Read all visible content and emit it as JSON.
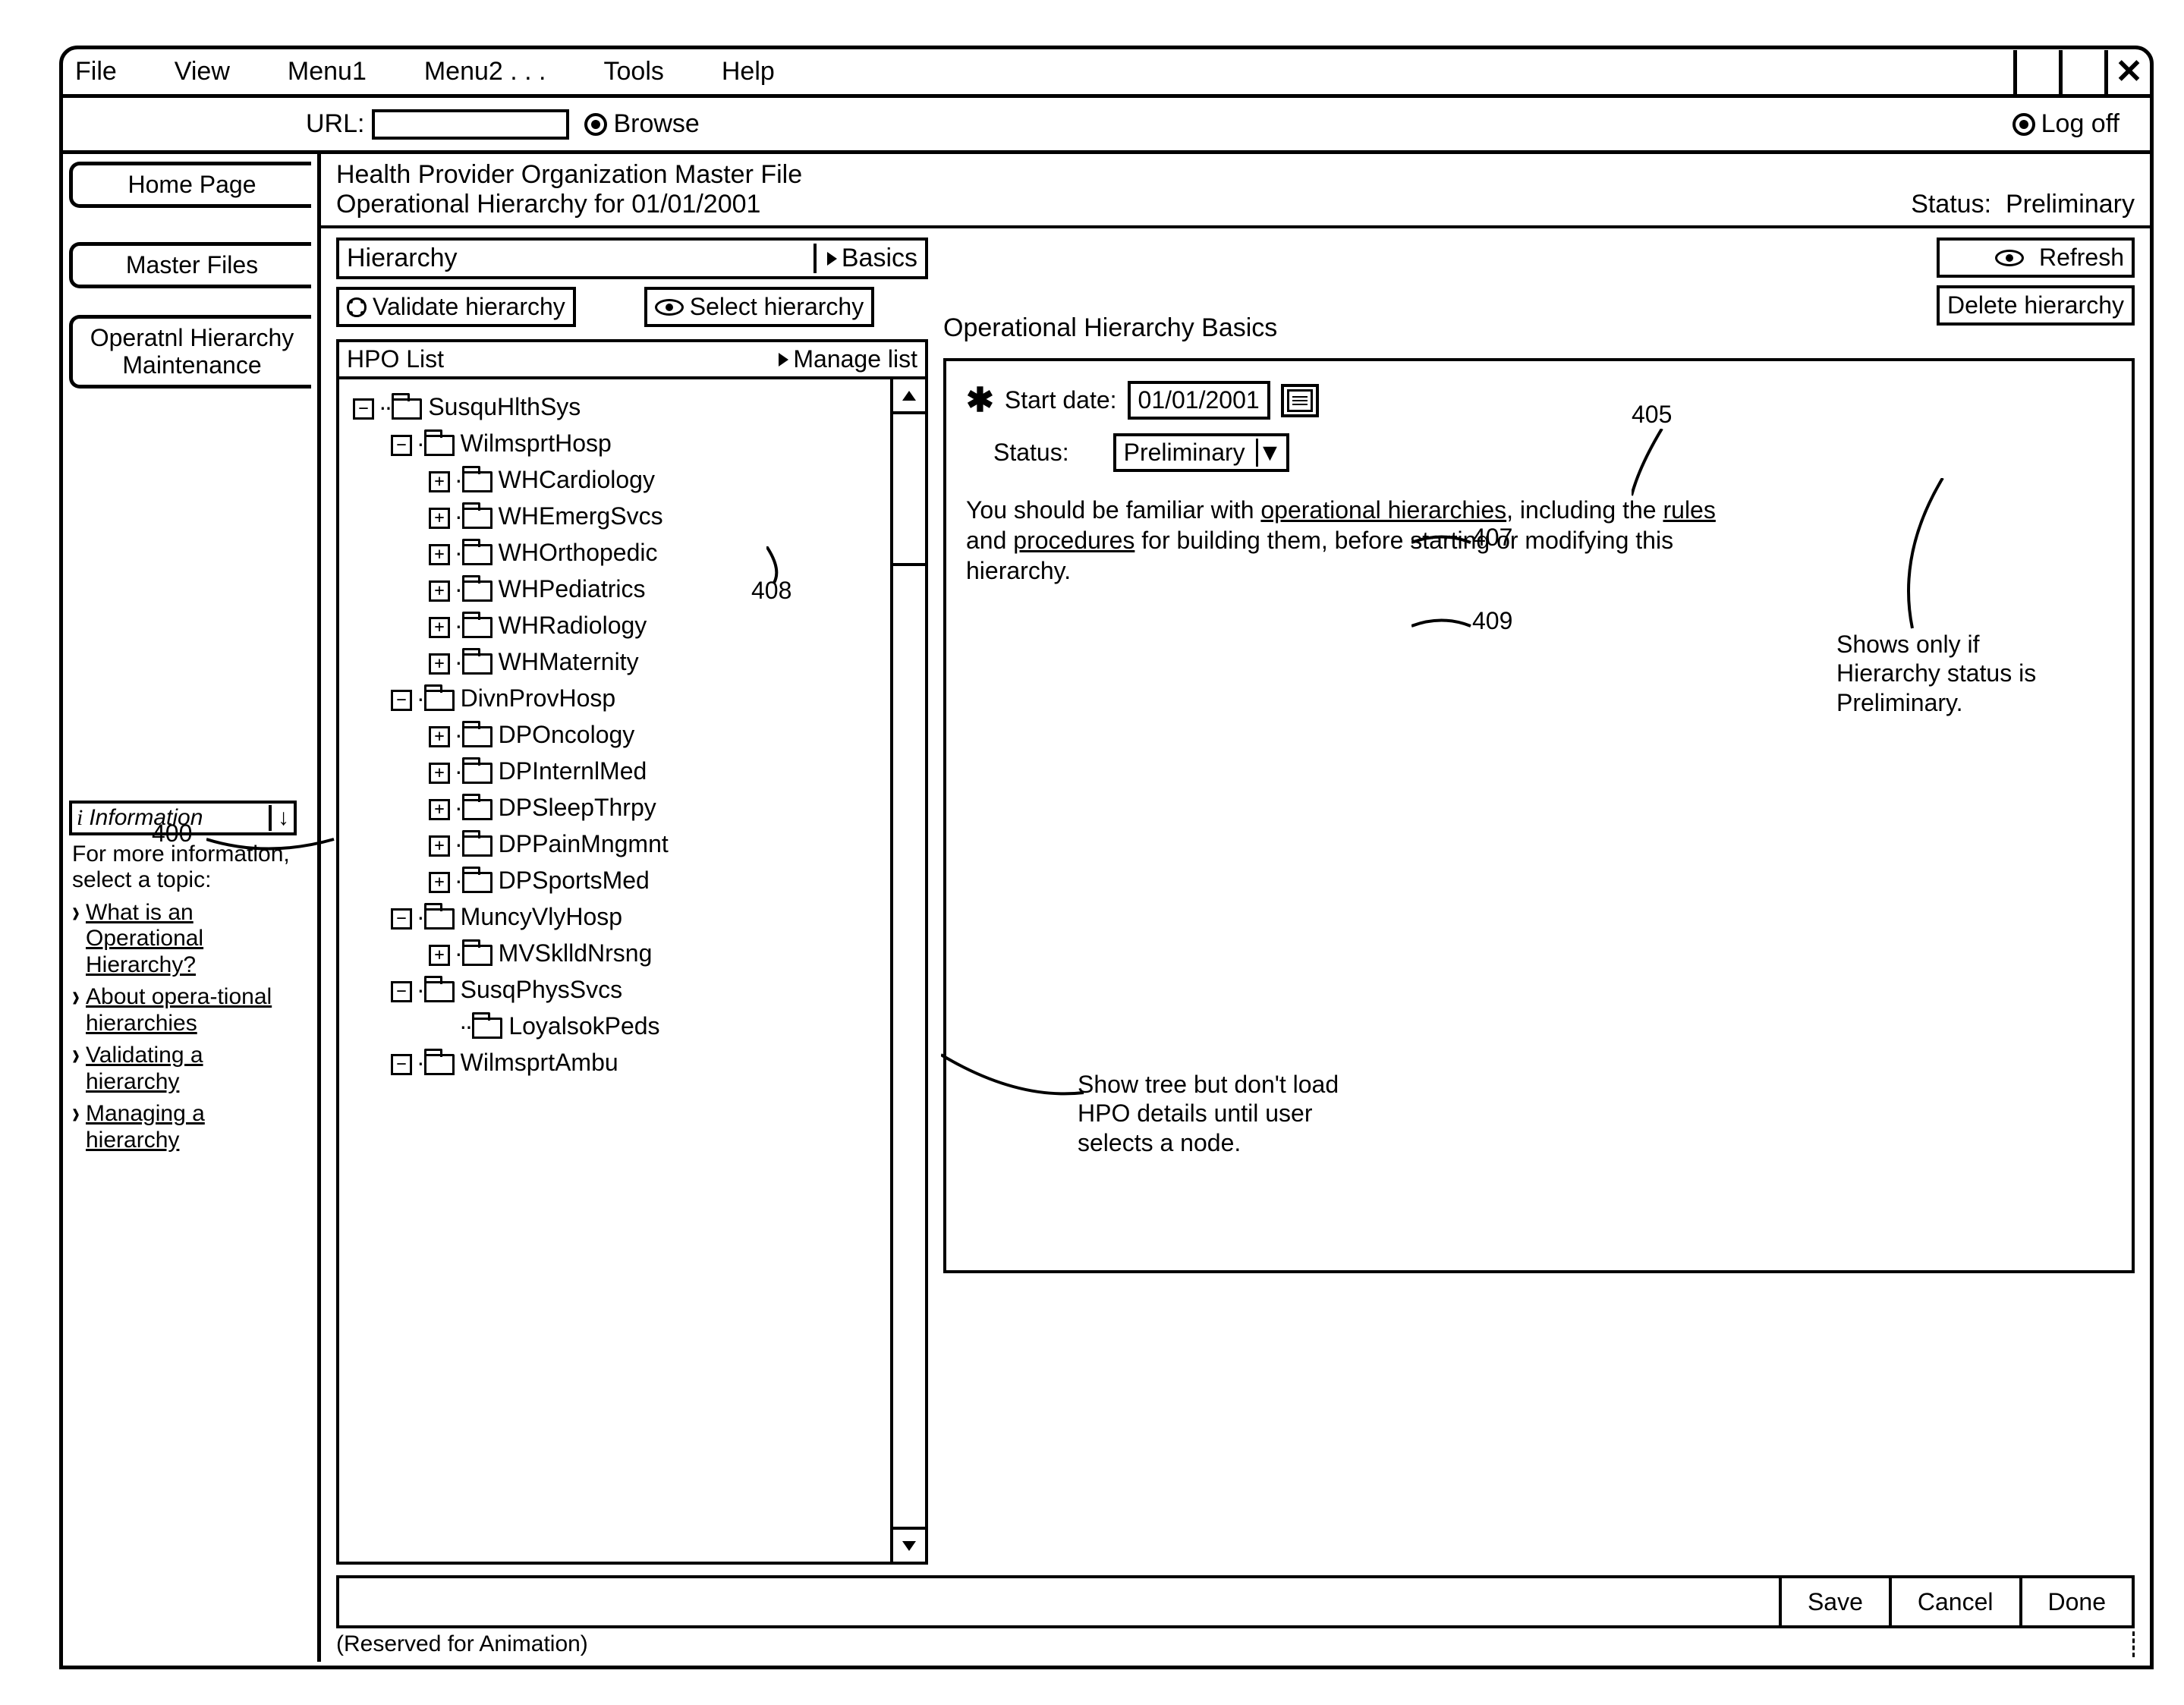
{
  "menubar": {
    "file": "File",
    "view": "View",
    "menu1": "Menu1",
    "menu2": "Menu2 . . .",
    "tools": "Tools",
    "help": "Help"
  },
  "window_close": "✕",
  "url": {
    "label": "URL:",
    "value": "",
    "browse": "Browse",
    "logoff": "Log off"
  },
  "left_tabs": {
    "home": "Home Page",
    "master_files": "Master Files",
    "op_hier_maint": "Operatnl Hierarchy Maintenance"
  },
  "info": {
    "header": "Information",
    "down_arrow": "↓",
    "intro": "For more information, select a topic:",
    "links": [
      "What is an Operational Hierarchy?",
      "About opera-tional hierarchies",
      "Validating a hierarchy",
      "Managing a hierarchy"
    ]
  },
  "content_header": {
    "title_line1": "Health Provider Organization Master File",
    "title_line2": "Operational Hierarchy for 01/01/2001",
    "status_label": "Status:",
    "status_value": "Preliminary"
  },
  "tool_header": {
    "hierarchy": "Hierarchy",
    "basics": "Basics",
    "validate": "Validate hierarchy",
    "select": "Select hierarchy"
  },
  "hpo": {
    "head": "HPO List",
    "manage": "Manage list",
    "nodes": {
      "n0": "SusquHlthSys",
      "n1": "WilmsprtHosp",
      "n2": "WHCardiology",
      "n3": "WHEmergSvcs",
      "n4": "WHOrthopedic",
      "n5": "WHPediatrics",
      "n6": "WHRadiology",
      "n7": "WHMaternity",
      "n8": "DivnProvHosp",
      "n9": "DPOncology",
      "n10": "DPInternlMed",
      "n11": "DPSleepThrpy",
      "n12": "DPPainMngmnt",
      "n13": "DPSportsMed",
      "n14": "MuncyVlyHosp",
      "n15": "MVSklldNrsng",
      "n16": "SusqPhysSvcs",
      "n17": "LoyalsokPeds",
      "n18": "WilmsprtAmbu"
    }
  },
  "right": {
    "title": "Operational Hierarchy Basics",
    "refresh": "Refresh",
    "delete": "Delete hierarchy",
    "start_date_label": "Start date:",
    "start_date_value": "01/01/2001",
    "status_label": "Status:",
    "status_value": "Preliminary",
    "note_pre": "You should be familiar with ",
    "note_link1": "operational hierarchies",
    "note_mid1": ", including the ",
    "note_link2": "rules",
    "note_mid2": " and ",
    "note_link3": "procedures",
    "note_post": " for building them, before starting or modifying this hierarchy."
  },
  "actions": {
    "save": "Save",
    "cancel": "Cancel",
    "done": "Done"
  },
  "animation_note": "(Reserved for Animation)",
  "annotations": {
    "a400": "400",
    "a405": "405",
    "a407": "407",
    "a408": "408",
    "a409": "409",
    "shows_only": "Shows only if Hierarchy status is Preliminary.",
    "tree_note": "Show tree but don't load HPO details until user selects a node."
  }
}
